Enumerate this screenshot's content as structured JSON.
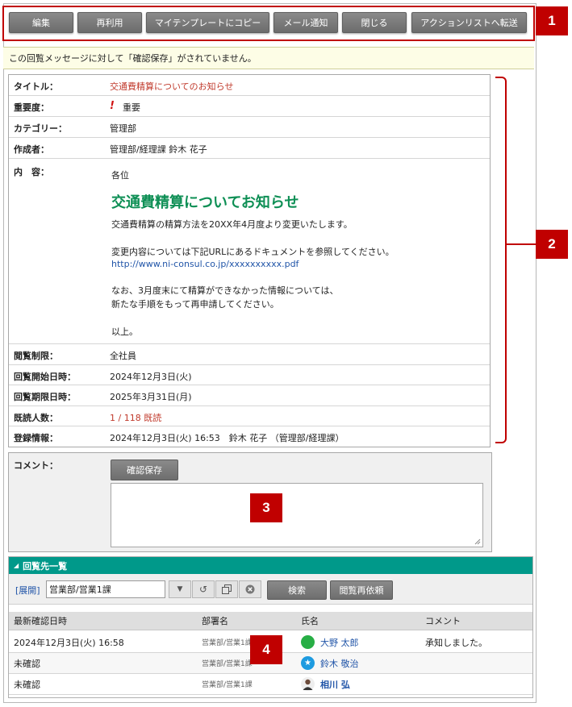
{
  "toolbar": {
    "buttons": [
      "編集",
      "再利用",
      "マイテンプレートにコピー",
      "メール通知",
      "閉じる",
      "アクションリストへ転送"
    ],
    "badge": "1"
  },
  "notice": "この回覧メッセージに対して「確認保存」がされていません。",
  "detail": {
    "title_label": "タイトル：",
    "title_value": "交通費精算についてのお知らせ",
    "importance_label": "重要度：",
    "importance_mark": "!",
    "importance_value": "重要",
    "category_label": "カテゴリー：",
    "category_value": "管理部",
    "author_label": "作成者：",
    "author_value": "管理部/経理課 鈴木 花子",
    "content_label": "内　容：",
    "content": {
      "greeting": "各位",
      "heading": "交通費精算についてお知らせ",
      "line1": "交通費精算の精算方法を20XX年4月度より変更いたします。",
      "line2": "変更内容については下記URLにあるドキュメントを参照してください。",
      "url": "http://www.ni-consul.co.jp/xxxxxxxxxx.pdf",
      "line3": "なお、3月度末にて精算ができなかった情報については、",
      "line4": "新たな手順をもって再申請してください。",
      "closing": "以上。"
    },
    "scope_label": "閲覧制限：",
    "scope_value": "全社員",
    "start_label": "回覧開始日時：",
    "start_value": "2024年12月3日(火)",
    "end_label": "回覧期限日時：",
    "end_value": "2025年3月31日(月)",
    "read_label": "既読人数：",
    "read_value": "1 / 118 既読",
    "reg_label": "登録情報：",
    "reg_value": "2024年12月3日(火) 16:53　鈴木 花子 （管理部/経理課）",
    "badge": "2"
  },
  "comment": {
    "label": "コメント：",
    "save_button": "確認保存",
    "badge": "3"
  },
  "list": {
    "title": "回覧先一覧",
    "expand": "[展開]",
    "dept_value": "営業部/営業1課",
    "search_button": "検索",
    "request_button": "閲覧再依頼",
    "columns": [
      "最新確認日時",
      "部署名",
      "氏名",
      "コメント"
    ],
    "rows": [
      {
        "date": "2024年12月3日(火) 16:58",
        "dept": "営業部/営業1課",
        "name": "大野 太郎",
        "comment": "承知しました。",
        "avatar": "green-circle"
      },
      {
        "date": "未確認",
        "dept": "営業部/営業1課",
        "name": "鈴木 敬治",
        "comment": "",
        "avatar": "blue-star"
      },
      {
        "date": "未確認",
        "dept": "営業部/営業1課",
        "name": "相川 弘",
        "comment": "",
        "avatar": "person-photo"
      }
    ],
    "badge": "4"
  }
}
